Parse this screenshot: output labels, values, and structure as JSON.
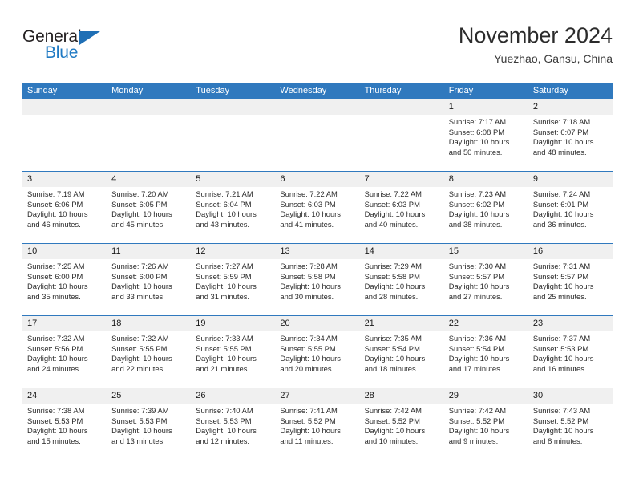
{
  "logo": {
    "word1": "General",
    "word2": "Blue",
    "triangle_icon": "triangle-icon",
    "blue": "#1f7ac4"
  },
  "header": {
    "title": "November 2024",
    "subtitle": "Yuezhao, Gansu, China"
  },
  "colors": {
    "header_blue": "#3079be",
    "date_band": "#f0f0f0",
    "text": "#2b2b2b"
  },
  "weekdays": [
    "Sunday",
    "Monday",
    "Tuesday",
    "Wednesday",
    "Thursday",
    "Friday",
    "Saturday"
  ],
  "labels": {
    "sunrise": "Sunrise:",
    "sunset": "Sunset:",
    "daylight": "Daylight:"
  },
  "weeks": [
    [
      {
        "date": "",
        "sunrise": "",
        "sunset": "",
        "daylight": "",
        "daylight2": ""
      },
      {
        "date": "",
        "sunrise": "",
        "sunset": "",
        "daylight": "",
        "daylight2": ""
      },
      {
        "date": "",
        "sunrise": "",
        "sunset": "",
        "daylight": "",
        "daylight2": ""
      },
      {
        "date": "",
        "sunrise": "",
        "sunset": "",
        "daylight": "",
        "daylight2": ""
      },
      {
        "date": "",
        "sunrise": "",
        "sunset": "",
        "daylight": "",
        "daylight2": ""
      },
      {
        "date": "1",
        "sunrise": "Sunrise: 7:17 AM",
        "sunset": "Sunset: 6:08 PM",
        "daylight": "Daylight: 10 hours",
        "daylight2": "and 50 minutes."
      },
      {
        "date": "2",
        "sunrise": "Sunrise: 7:18 AM",
        "sunset": "Sunset: 6:07 PM",
        "daylight": "Daylight: 10 hours",
        "daylight2": "and 48 minutes."
      }
    ],
    [
      {
        "date": "3",
        "sunrise": "Sunrise: 7:19 AM",
        "sunset": "Sunset: 6:06 PM",
        "daylight": "Daylight: 10 hours",
        "daylight2": "and 46 minutes."
      },
      {
        "date": "4",
        "sunrise": "Sunrise: 7:20 AM",
        "sunset": "Sunset: 6:05 PM",
        "daylight": "Daylight: 10 hours",
        "daylight2": "and 45 minutes."
      },
      {
        "date": "5",
        "sunrise": "Sunrise: 7:21 AM",
        "sunset": "Sunset: 6:04 PM",
        "daylight": "Daylight: 10 hours",
        "daylight2": "and 43 minutes."
      },
      {
        "date": "6",
        "sunrise": "Sunrise: 7:22 AM",
        "sunset": "Sunset: 6:03 PM",
        "daylight": "Daylight: 10 hours",
        "daylight2": "and 41 minutes."
      },
      {
        "date": "7",
        "sunrise": "Sunrise: 7:22 AM",
        "sunset": "Sunset: 6:03 PM",
        "daylight": "Daylight: 10 hours",
        "daylight2": "and 40 minutes."
      },
      {
        "date": "8",
        "sunrise": "Sunrise: 7:23 AM",
        "sunset": "Sunset: 6:02 PM",
        "daylight": "Daylight: 10 hours",
        "daylight2": "and 38 minutes."
      },
      {
        "date": "9",
        "sunrise": "Sunrise: 7:24 AM",
        "sunset": "Sunset: 6:01 PM",
        "daylight": "Daylight: 10 hours",
        "daylight2": "and 36 minutes."
      }
    ],
    [
      {
        "date": "10",
        "sunrise": "Sunrise: 7:25 AM",
        "sunset": "Sunset: 6:00 PM",
        "daylight": "Daylight: 10 hours",
        "daylight2": "and 35 minutes."
      },
      {
        "date": "11",
        "sunrise": "Sunrise: 7:26 AM",
        "sunset": "Sunset: 6:00 PM",
        "daylight": "Daylight: 10 hours",
        "daylight2": "and 33 minutes."
      },
      {
        "date": "12",
        "sunrise": "Sunrise: 7:27 AM",
        "sunset": "Sunset: 5:59 PM",
        "daylight": "Daylight: 10 hours",
        "daylight2": "and 31 minutes."
      },
      {
        "date": "13",
        "sunrise": "Sunrise: 7:28 AM",
        "sunset": "Sunset: 5:58 PM",
        "daylight": "Daylight: 10 hours",
        "daylight2": "and 30 minutes."
      },
      {
        "date": "14",
        "sunrise": "Sunrise: 7:29 AM",
        "sunset": "Sunset: 5:58 PM",
        "daylight": "Daylight: 10 hours",
        "daylight2": "and 28 minutes."
      },
      {
        "date": "15",
        "sunrise": "Sunrise: 7:30 AM",
        "sunset": "Sunset: 5:57 PM",
        "daylight": "Daylight: 10 hours",
        "daylight2": "and 27 minutes."
      },
      {
        "date": "16",
        "sunrise": "Sunrise: 7:31 AM",
        "sunset": "Sunset: 5:57 PM",
        "daylight": "Daylight: 10 hours",
        "daylight2": "and 25 minutes."
      }
    ],
    [
      {
        "date": "17",
        "sunrise": "Sunrise: 7:32 AM",
        "sunset": "Sunset: 5:56 PM",
        "daylight": "Daylight: 10 hours",
        "daylight2": "and 24 minutes."
      },
      {
        "date": "18",
        "sunrise": "Sunrise: 7:32 AM",
        "sunset": "Sunset: 5:55 PM",
        "daylight": "Daylight: 10 hours",
        "daylight2": "and 22 minutes."
      },
      {
        "date": "19",
        "sunrise": "Sunrise: 7:33 AM",
        "sunset": "Sunset: 5:55 PM",
        "daylight": "Daylight: 10 hours",
        "daylight2": "and 21 minutes."
      },
      {
        "date": "20",
        "sunrise": "Sunrise: 7:34 AM",
        "sunset": "Sunset: 5:55 PM",
        "daylight": "Daylight: 10 hours",
        "daylight2": "and 20 minutes."
      },
      {
        "date": "21",
        "sunrise": "Sunrise: 7:35 AM",
        "sunset": "Sunset: 5:54 PM",
        "daylight": "Daylight: 10 hours",
        "daylight2": "and 18 minutes."
      },
      {
        "date": "22",
        "sunrise": "Sunrise: 7:36 AM",
        "sunset": "Sunset: 5:54 PM",
        "daylight": "Daylight: 10 hours",
        "daylight2": "and 17 minutes."
      },
      {
        "date": "23",
        "sunrise": "Sunrise: 7:37 AM",
        "sunset": "Sunset: 5:53 PM",
        "daylight": "Daylight: 10 hours",
        "daylight2": "and 16 minutes."
      }
    ],
    [
      {
        "date": "24",
        "sunrise": "Sunrise: 7:38 AM",
        "sunset": "Sunset: 5:53 PM",
        "daylight": "Daylight: 10 hours",
        "daylight2": "and 15 minutes."
      },
      {
        "date": "25",
        "sunrise": "Sunrise: 7:39 AM",
        "sunset": "Sunset: 5:53 PM",
        "daylight": "Daylight: 10 hours",
        "daylight2": "and 13 minutes."
      },
      {
        "date": "26",
        "sunrise": "Sunrise: 7:40 AM",
        "sunset": "Sunset: 5:53 PM",
        "daylight": "Daylight: 10 hours",
        "daylight2": "and 12 minutes."
      },
      {
        "date": "27",
        "sunrise": "Sunrise: 7:41 AM",
        "sunset": "Sunset: 5:52 PM",
        "daylight": "Daylight: 10 hours",
        "daylight2": "and 11 minutes."
      },
      {
        "date": "28",
        "sunrise": "Sunrise: 7:42 AM",
        "sunset": "Sunset: 5:52 PM",
        "daylight": "Daylight: 10 hours",
        "daylight2": "and 10 minutes."
      },
      {
        "date": "29",
        "sunrise": "Sunrise: 7:42 AM",
        "sunset": "Sunset: 5:52 PM",
        "daylight": "Daylight: 10 hours",
        "daylight2": "and 9 minutes."
      },
      {
        "date": "30",
        "sunrise": "Sunrise: 7:43 AM",
        "sunset": "Sunset: 5:52 PM",
        "daylight": "Daylight: 10 hours",
        "daylight2": "and 8 minutes."
      }
    ]
  ]
}
